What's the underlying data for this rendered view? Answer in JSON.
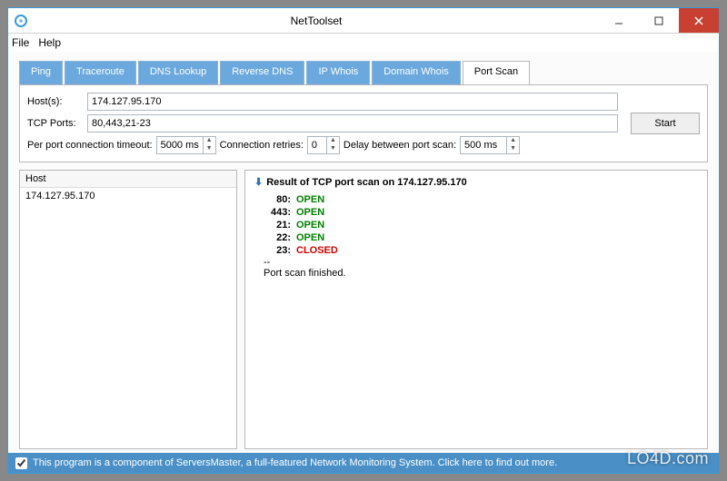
{
  "window": {
    "title": "NetToolset"
  },
  "menu": {
    "file": "File",
    "help": "Help"
  },
  "tabs": [
    {
      "label": "Ping",
      "active": false
    },
    {
      "label": "Traceroute",
      "active": false
    },
    {
      "label": "DNS Lookup",
      "active": false
    },
    {
      "label": "Reverse DNS",
      "active": false
    },
    {
      "label": "IP Whois",
      "active": false
    },
    {
      "label": "Domain Whois",
      "active": false
    },
    {
      "label": "Port Scan",
      "active": true
    }
  ],
  "form": {
    "hosts_label": "Host(s):",
    "hosts_value": "174.127.95.170",
    "ports_label": "TCP Ports:",
    "ports_value": "80,443,21-23",
    "timeout_label": "Per port connection timeout:",
    "timeout_value": "5000 ms",
    "retries_label": "Connection retries:",
    "retries_value": "0",
    "delay_label": "Delay between port scan:",
    "delay_value": "500 ms",
    "start_label": "Start"
  },
  "hostlist": {
    "header": "Host",
    "items": [
      "174.127.95.170"
    ]
  },
  "result": {
    "title": "Result of TCP port scan on 174.127.95.170",
    "lines": [
      {
        "port": "80:",
        "status": "OPEN",
        "cls": "open"
      },
      {
        "port": "443:",
        "status": "OPEN",
        "cls": "open"
      },
      {
        "port": "21:",
        "status": "OPEN",
        "cls": "open"
      },
      {
        "port": "22:",
        "status": "OPEN",
        "cls": "open"
      },
      {
        "port": "23:",
        "status": "CLOSED",
        "cls": "closed"
      }
    ],
    "sep": "--",
    "finished": "Port scan finished."
  },
  "footer": {
    "text": "This program is a component of ServersMaster, a full-featured Network Monitoring System. Click here to find out more."
  },
  "watermark": "LO4D.com"
}
